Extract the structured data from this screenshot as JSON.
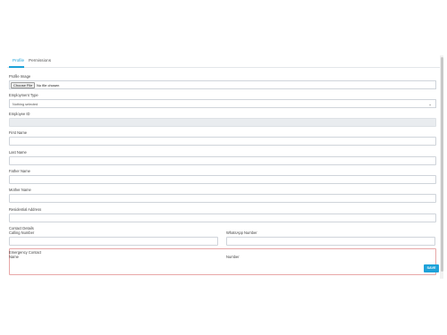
{
  "tabs": [
    {
      "label": "Profile",
      "active": true
    },
    {
      "label": "Permissions",
      "active": false
    }
  ],
  "accent_color": "#1ea2d9",
  "form": {
    "profile_image": {
      "label": "Profile Image",
      "button": "Choose File",
      "status": "No file chosen"
    },
    "employment_type": {
      "label": "Employment Type",
      "selected": "Nothing selected",
      "icon": "chevron-down-icon"
    },
    "employee_id": {
      "label": "Employee ID",
      "value": ""
    },
    "first_name": {
      "label": "First Name",
      "value": ""
    },
    "last_name": {
      "label": "Last Name",
      "value": ""
    },
    "father_name": {
      "label": "Father Name",
      "value": ""
    },
    "mother_name": {
      "label": "Mother Name",
      "value": ""
    },
    "residential_address": {
      "label": "Residential Address",
      "value": ""
    },
    "contact_details": {
      "label": "Contact Details",
      "calling_number": {
        "label": "Calling Number",
        "value": ""
      },
      "whatsapp_number": {
        "label": "WhatsApp Number",
        "value": ""
      }
    },
    "emergency_contact": {
      "label": "Emergency Contact",
      "name_label": "Name",
      "number_label": "Number",
      "border_color": "#e8a7a7"
    }
  },
  "save_label": "SAVE"
}
